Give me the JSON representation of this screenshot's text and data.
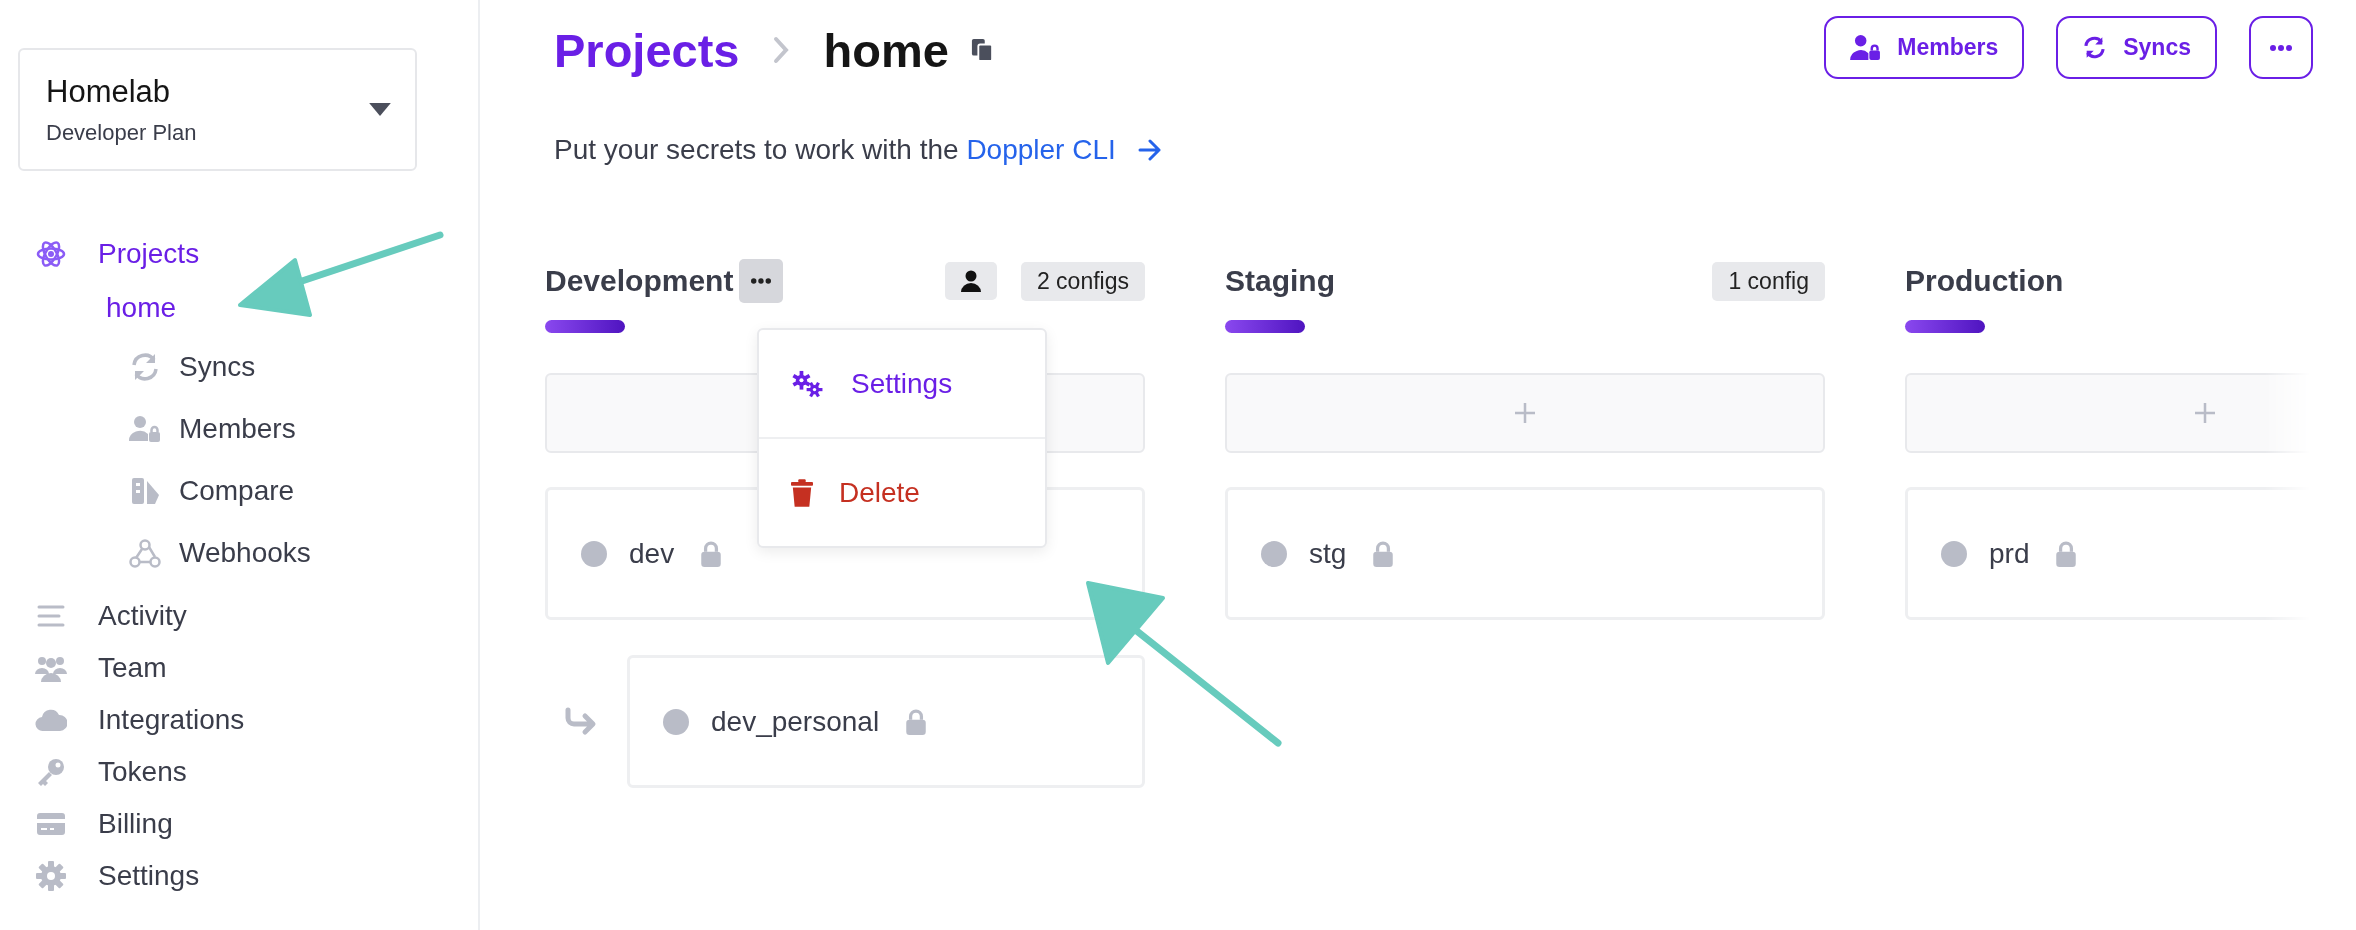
{
  "workplace": {
    "name": "Homelab",
    "plan": "Developer Plan"
  },
  "sidebar": {
    "items": [
      {
        "label": "Projects",
        "selected": true,
        "children": [
          {
            "label": "home",
            "selected": true,
            "children": [
              {
                "label": "Syncs",
                "selected": false
              },
              {
                "label": "Members",
                "selected": false
              },
              {
                "label": "Compare",
                "selected": false
              },
              {
                "label": "Webhooks",
                "selected": false
              }
            ]
          }
        ]
      },
      {
        "label": "Activity",
        "selected": false
      },
      {
        "label": "Team",
        "selected": false
      },
      {
        "label": "Integrations",
        "selected": false
      },
      {
        "label": "Tokens",
        "selected": false
      },
      {
        "label": "Billing",
        "selected": false
      },
      {
        "label": "Settings",
        "selected": false
      }
    ]
  },
  "breadcrumb": {
    "parent": "Projects",
    "current": "home"
  },
  "header_buttons": [
    {
      "kind": "members",
      "label": "Members"
    },
    {
      "kind": "syncs",
      "label": "Syncs"
    },
    {
      "kind": "more"
    }
  ],
  "hint": {
    "text": "Put your secrets to work with the",
    "link": "Doppler CLI"
  },
  "environments": [
    {
      "name": "Development",
      "menu_open": true,
      "user_badge": true,
      "count": "2 configs",
      "configs": [
        {
          "name": "dev",
          "locked": true,
          "children": [
            {
              "name": "dev_personal",
              "locked": true
            }
          ]
        }
      ]
    },
    {
      "name": "Staging",
      "menu_open": false,
      "user_badge": false,
      "count": "1 config",
      "configs": [
        {
          "name": "stg",
          "locked": true
        }
      ]
    },
    {
      "name": "Production",
      "menu_open": false,
      "user_badge": false,
      "configs": [
        {
          "name": "prd",
          "locked": true
        }
      ]
    }
  ],
  "environment_menu": [
    {
      "kind": "settings",
      "label": "Settings"
    },
    {
      "kind": "delete",
      "label": "Delete"
    }
  ],
  "annotations": [
    {
      "kind": "arrow"
    },
    {
      "kind": "arrow"
    }
  ]
}
